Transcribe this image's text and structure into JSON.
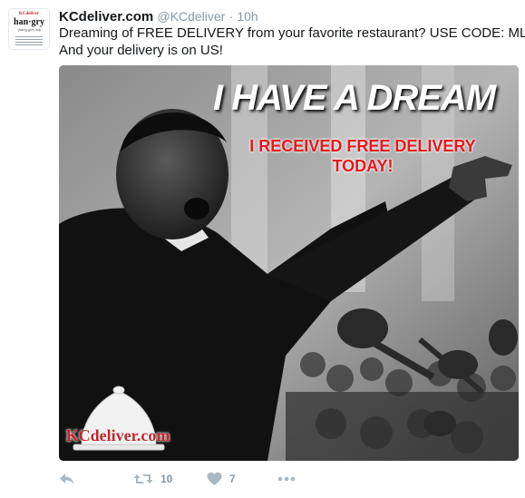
{
  "tweet": {
    "display_name": "KCdeliver.com",
    "handle": "@KCdeliver",
    "separator": "·",
    "time": "10h",
    "text_line1": "Dreaming of FREE DELIVERY from your favorite restaurant? USE CODE: MLK",
    "text_line2": "And your delivery is on US!"
  },
  "avatar": {
    "brand": "KCdeliver",
    "word": "han·gry",
    "subtitle": "(hang-grē) adj"
  },
  "media": {
    "headline": "I HAVE A DREAM",
    "red_line1": "I RECEIVED FREE DELIVERY",
    "red_line2": "TODAY!",
    "logo_text": "KCdeliver.com"
  },
  "actions": {
    "reply_icon": "reply-icon",
    "retweet_icon": "retweet-icon",
    "retweet_count": "10",
    "like_icon": "heart-icon",
    "like_count": "7",
    "more_icon": "more-icon"
  },
  "colors": {
    "action_gray": "#aab8c2",
    "meta_gray": "#8899a6",
    "headline_red": "#e8161c",
    "logo_red": "#c0272d"
  }
}
